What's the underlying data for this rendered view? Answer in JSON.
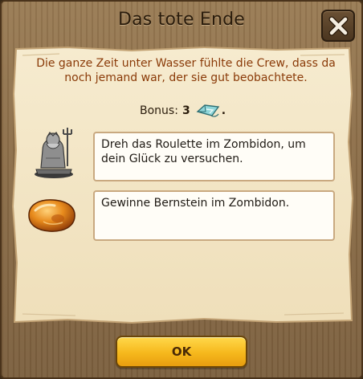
{
  "dialog": {
    "title": "Das tote Ende",
    "close_icon": "close-x-icon"
  },
  "description": "Die ganze Zeit unter Wasser fühlte die Crew, dass da noch jemand war, der sie gut beobachtete.",
  "bonus": {
    "label": "Bonus:",
    "value": "3",
    "icon": "map-scroll-icon",
    "suffix": "."
  },
  "tasks": [
    {
      "icon": "poseidon-statue-icon",
      "text": "Dreh das Roulette im Zombidon, um dein Glück zu versuchen."
    },
    {
      "icon": "amber-stone-icon",
      "text": "Gewinne Bernstein im Zombidon."
    }
  ],
  "buttons": {
    "ok_label": "OK"
  },
  "colors": {
    "description_text": "#8a3a08",
    "parchment": "#f3e6c6",
    "ok_button": "#f6b81c",
    "frame_wood": "#8a6c47"
  }
}
